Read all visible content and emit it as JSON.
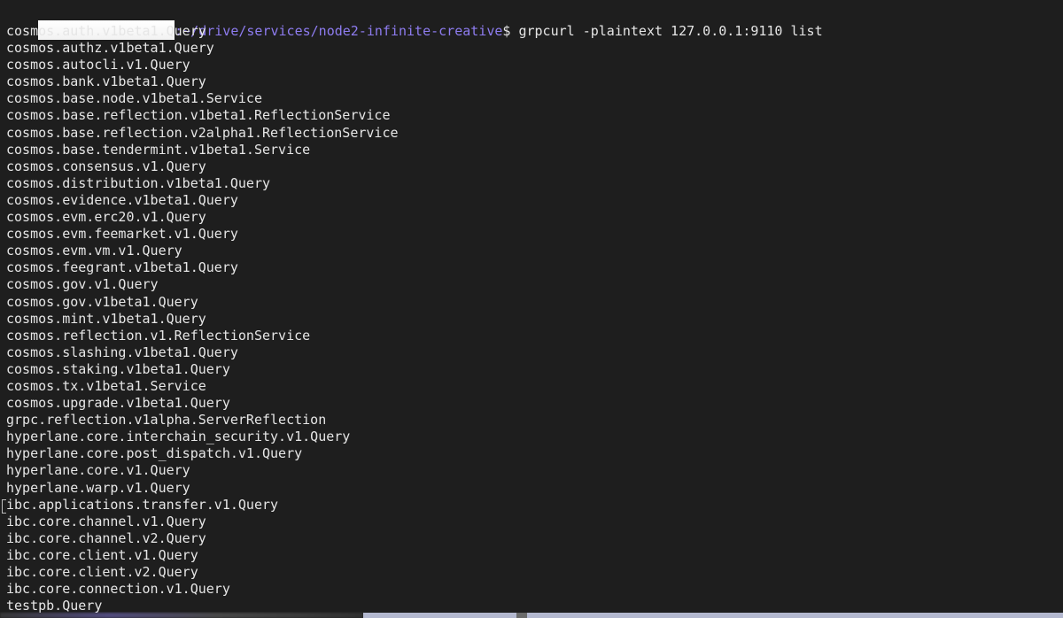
{
  "prompt": {
    "path": ":~/drive/services/node2-infinite-creative",
    "symbol": "$",
    "command": " grpcurl -plaintext 127.0.0.1:9110 list"
  },
  "output_lines": [
    "cosmos.auth.v1beta1.Query",
    "cosmos.authz.v1beta1.Query",
    "cosmos.autocli.v1.Query",
    "cosmos.bank.v1beta1.Query",
    "cosmos.base.node.v1beta1.Service",
    "cosmos.base.reflection.v1beta1.ReflectionService",
    "cosmos.base.reflection.v2alpha1.ReflectionService",
    "cosmos.base.tendermint.v1beta1.Service",
    "cosmos.consensus.v1.Query",
    "cosmos.distribution.v1beta1.Query",
    "cosmos.evidence.v1beta1.Query",
    "cosmos.evm.erc20.v1.Query",
    "cosmos.evm.feemarket.v1.Query",
    "cosmos.evm.vm.v1.Query",
    "cosmos.feegrant.v1beta1.Query",
    "cosmos.gov.v1.Query",
    "cosmos.gov.v1beta1.Query",
    "cosmos.mint.v1beta1.Query",
    "cosmos.reflection.v1.ReflectionService",
    "cosmos.slashing.v1beta1.Query",
    "cosmos.staking.v1beta1.Query",
    "cosmos.tx.v1beta1.Service",
    "cosmos.upgrade.v1beta1.Query",
    "grpc.reflection.v1alpha.ServerReflection",
    "hyperlane.core.interchain_security.v1.Query",
    "hyperlane.core.post_dispatch.v1.Query",
    "hyperlane.core.v1.Query",
    "hyperlane.warp.v1.Query",
    "ibc.applications.transfer.v1.Query",
    "ibc.core.channel.v1.Query",
    "ibc.core.channel.v2.Query",
    "ibc.core.client.v1.Query",
    "ibc.core.client.v2.Query",
    "ibc.core.connection.v1.Query",
    "testpb.Query"
  ]
}
